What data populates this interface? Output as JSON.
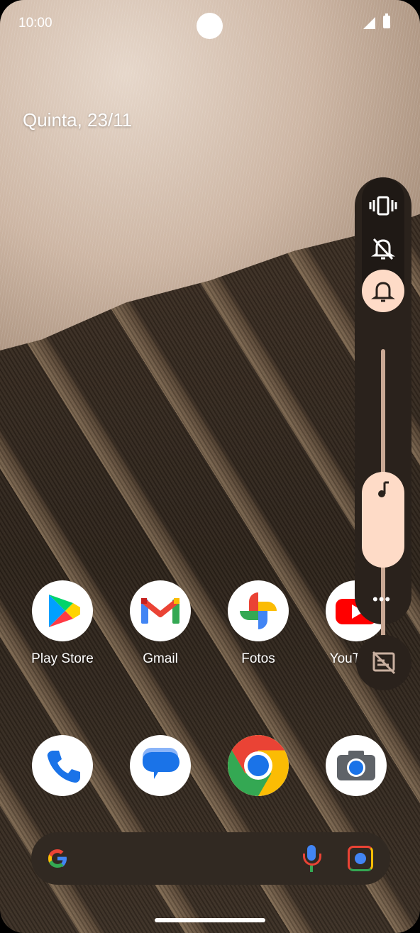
{
  "status_bar": {
    "time": "10:00"
  },
  "home": {
    "date": "Quinta, 23/11"
  },
  "apps_row1": [
    {
      "label": "Play Store",
      "icon": "play-store-icon"
    },
    {
      "label": "Gmail",
      "icon": "gmail-icon"
    },
    {
      "label": "Fotos",
      "icon": "photos-icon"
    },
    {
      "label": "YouTube",
      "icon": "youtube-icon"
    }
  ],
  "dock": [
    {
      "icon": "phone-icon"
    },
    {
      "icon": "messages-icon"
    },
    {
      "icon": "chrome-icon"
    },
    {
      "icon": "camera-icon"
    }
  ],
  "search_bar": {
    "logo": "google-g-icon",
    "mic": "microphone-icon",
    "lens": "lens-icon"
  },
  "volume_panel": {
    "modes": [
      "vibrate-icon",
      "mute-icon",
      "ring-icon"
    ],
    "active_mode": "ring",
    "media_level": 0.33,
    "more_label": "•••"
  },
  "colors": {
    "accent": "#fedbc7",
    "panel": "#2a221c",
    "searchbar": "#312922"
  }
}
